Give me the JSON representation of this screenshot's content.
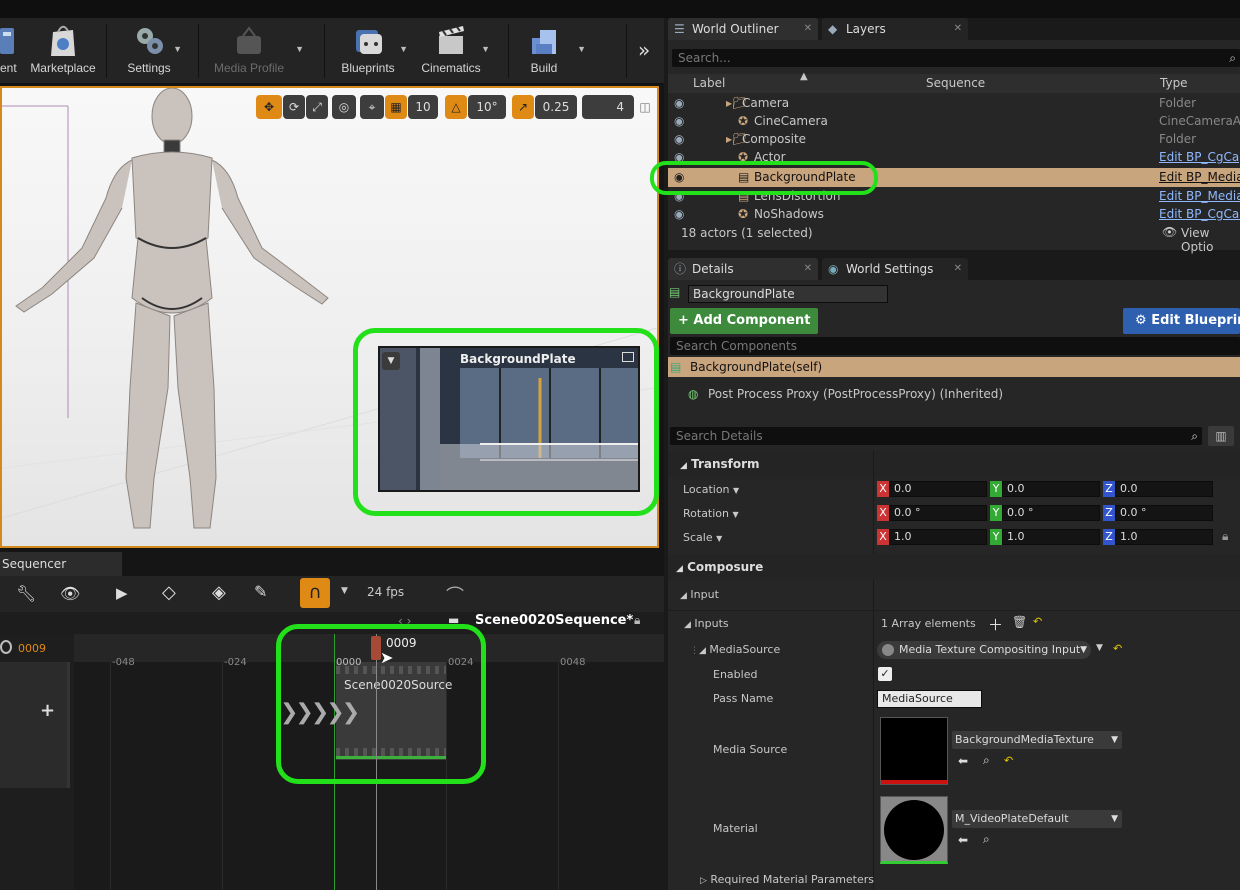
{
  "toolbar": {
    "items": [
      {
        "label": "ent",
        "icon": "content-icon"
      },
      {
        "label": "Marketplace",
        "icon": "marketplace-icon"
      },
      {
        "label": "Settings",
        "icon": "settings-icon"
      },
      {
        "label": "Media Profile",
        "icon": "media-profile-icon"
      },
      {
        "label": "Blueprints",
        "icon": "blueprints-icon"
      },
      {
        "label": "Cinematics",
        "icon": "cinematics-icon"
      },
      {
        "label": "Build",
        "icon": "build-icon"
      }
    ],
    "overflow": "»"
  },
  "viewport": {
    "grid_snap": "10",
    "rot_snap": "10°",
    "scale_snap": "0.25",
    "camera_speed": "4",
    "pip_title": "BackgroundPlate"
  },
  "sequencer": {
    "tab_label": "Sequencer",
    "fps": "24 fps",
    "current_frame": "0009",
    "playhead_label": "0009",
    "sequence_name": "Scene0020Sequence*",
    "ticks": [
      "-048",
      "-024",
      "0000",
      "0024",
      "0048"
    ],
    "clip_label": "Scene0020Source",
    "add_button": "+"
  },
  "outliner": {
    "tabs": [
      "World Outliner",
      "Layers"
    ],
    "search_placeholder": "Search...",
    "columns": [
      "Label",
      "Sequence",
      "Type"
    ],
    "rows": [
      {
        "label": "Camera",
        "type": "Folder",
        "link": false
      },
      {
        "label": "CineCamera",
        "type": "CineCameraAct",
        "link": false
      },
      {
        "label": "Composite",
        "type": "Folder",
        "link": false
      },
      {
        "label": "Actor",
        "type": "Edit BP_CgCap",
        "link": true
      },
      {
        "label": "BackgroundPlate",
        "type": "Edit BP_Media",
        "link": true
      },
      {
        "label": "LensDistortion",
        "type": "Edit BP_Media",
        "link": true
      },
      {
        "label": "NoShadows",
        "type": "Edit BP_CgCar",
        "link": true
      }
    ],
    "footer": "18 actors (1 selected)",
    "view_options": "View Optio"
  },
  "details": {
    "tabs": [
      "Details",
      "World Settings"
    ],
    "actor_name": "BackgroundPlate",
    "add_component": "+ Add Component",
    "edit_blueprint": "Edit Blueprin",
    "search_components": "Search Components",
    "self_component": "BackgroundPlate(self)",
    "inherited_component": "Post Process Proxy (PostProcessProxy) (Inherited)",
    "search_details": "Search Details",
    "transform": {
      "header": "Transform",
      "rows": [
        {
          "label": "Location",
          "x": "0.0",
          "y": "0.0",
          "z": "0.0"
        },
        {
          "label": "Rotation",
          "x": "0.0 °",
          "y": "0.0 °",
          "z": "0.0 °"
        },
        {
          "label": "Scale",
          "x": "1.0",
          "y": "1.0",
          "z": "1.0"
        }
      ]
    },
    "composure": {
      "header": "Composure",
      "input_header": "Input",
      "inputs_label": "Inputs",
      "inputs_value": "1 Array elements",
      "media_source_label": "MediaSource",
      "media_source_value": "Media Texture Compositing Input",
      "enabled_label": "Enabled",
      "pass_name_label": "Pass Name",
      "pass_name_value": "MediaSource",
      "media_source_asset_label": "Media Source",
      "media_source_asset": "BackgroundMediaTexture",
      "material_label": "Material",
      "material_asset": "M_VideoPlateDefault",
      "required_params": "Required Material Parameters"
    }
  }
}
